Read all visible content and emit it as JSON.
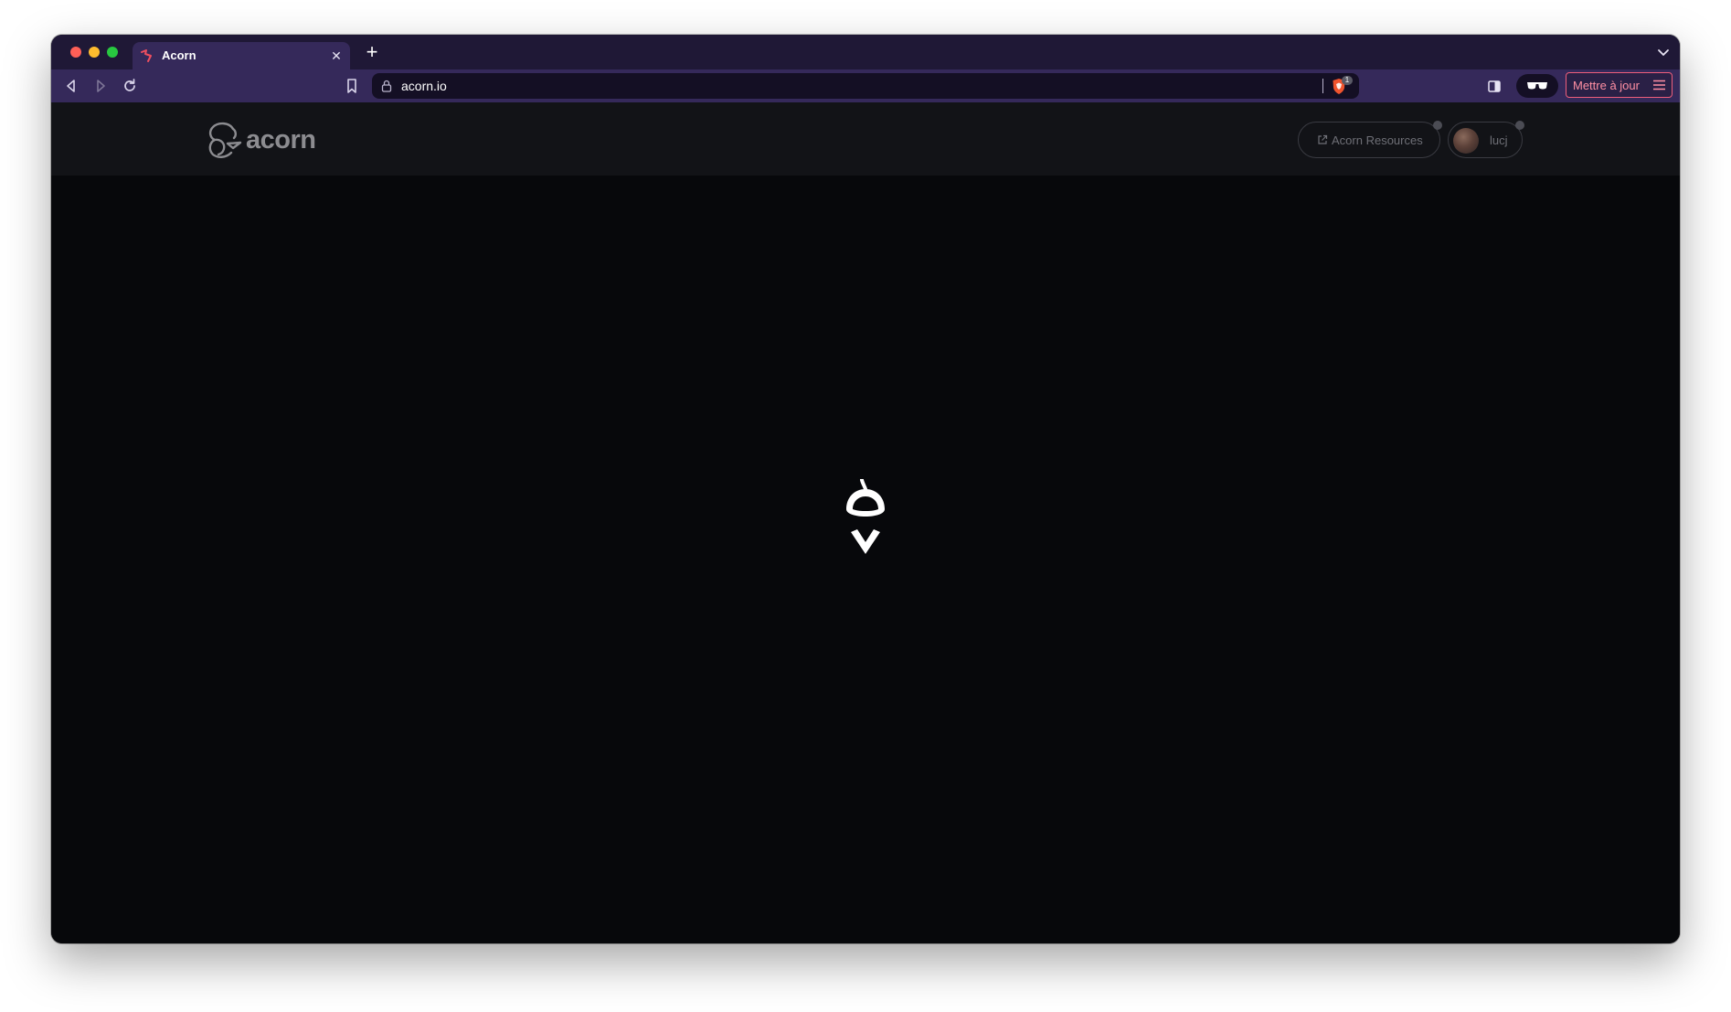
{
  "browser": {
    "tab": {
      "title": "Acorn",
      "favicon": "acorn-squirrel-icon",
      "close_glyph": "✕"
    },
    "new_tab_glyph": "+",
    "address_bar": {
      "url": "acorn.io",
      "lock": "lock-icon"
    },
    "shield_badge_count": "1",
    "update_button_label": "Mettre à jour",
    "colors": {
      "tabstrip": "#1f1836",
      "toolbar": "#35295a",
      "accent": "#ef5e7b"
    }
  },
  "site": {
    "logo_text": "acorn",
    "resources_label": "Acorn Resources",
    "user_label": "lucj",
    "loader": "acorn-loading-icon",
    "colors": {
      "header_bg": "#121317",
      "page_bg": "#07080b",
      "muted_text": "#6e6f76"
    }
  }
}
